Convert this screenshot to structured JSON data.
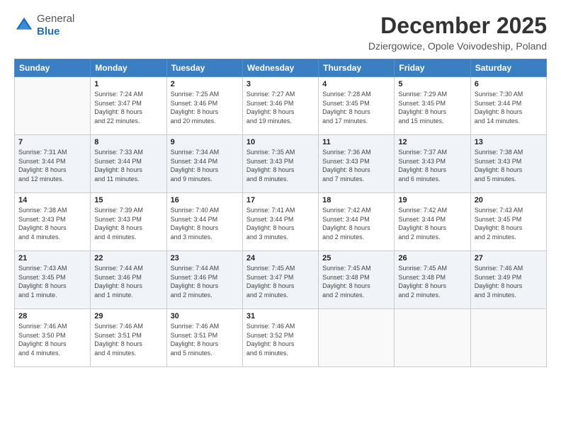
{
  "logo": {
    "general": "General",
    "blue": "Blue"
  },
  "header": {
    "month": "December 2025",
    "location": "Dziergowice, Opole Voivodeship, Poland"
  },
  "weekdays": [
    "Sunday",
    "Monday",
    "Tuesday",
    "Wednesday",
    "Thursday",
    "Friday",
    "Saturday"
  ],
  "weeks": [
    [
      {
        "day": "",
        "info": ""
      },
      {
        "day": "1",
        "info": "Sunrise: 7:24 AM\nSunset: 3:47 PM\nDaylight: 8 hours\nand 22 minutes."
      },
      {
        "day": "2",
        "info": "Sunrise: 7:25 AM\nSunset: 3:46 PM\nDaylight: 8 hours\nand 20 minutes."
      },
      {
        "day": "3",
        "info": "Sunrise: 7:27 AM\nSunset: 3:46 PM\nDaylight: 8 hours\nand 19 minutes."
      },
      {
        "day": "4",
        "info": "Sunrise: 7:28 AM\nSunset: 3:45 PM\nDaylight: 8 hours\nand 17 minutes."
      },
      {
        "day": "5",
        "info": "Sunrise: 7:29 AM\nSunset: 3:45 PM\nDaylight: 8 hours\nand 15 minutes."
      },
      {
        "day": "6",
        "info": "Sunrise: 7:30 AM\nSunset: 3:44 PM\nDaylight: 8 hours\nand 14 minutes."
      }
    ],
    [
      {
        "day": "7",
        "info": "Sunrise: 7:31 AM\nSunset: 3:44 PM\nDaylight: 8 hours\nand 12 minutes."
      },
      {
        "day": "8",
        "info": "Sunrise: 7:33 AM\nSunset: 3:44 PM\nDaylight: 8 hours\nand 11 minutes."
      },
      {
        "day": "9",
        "info": "Sunrise: 7:34 AM\nSunset: 3:44 PM\nDaylight: 8 hours\nand 9 minutes."
      },
      {
        "day": "10",
        "info": "Sunrise: 7:35 AM\nSunset: 3:43 PM\nDaylight: 8 hours\nand 8 minutes."
      },
      {
        "day": "11",
        "info": "Sunrise: 7:36 AM\nSunset: 3:43 PM\nDaylight: 8 hours\nand 7 minutes."
      },
      {
        "day": "12",
        "info": "Sunrise: 7:37 AM\nSunset: 3:43 PM\nDaylight: 8 hours\nand 6 minutes."
      },
      {
        "day": "13",
        "info": "Sunrise: 7:38 AM\nSunset: 3:43 PM\nDaylight: 8 hours\nand 5 minutes."
      }
    ],
    [
      {
        "day": "14",
        "info": "Sunrise: 7:38 AM\nSunset: 3:43 PM\nDaylight: 8 hours\nand 4 minutes."
      },
      {
        "day": "15",
        "info": "Sunrise: 7:39 AM\nSunset: 3:43 PM\nDaylight: 8 hours\nand 4 minutes."
      },
      {
        "day": "16",
        "info": "Sunrise: 7:40 AM\nSunset: 3:44 PM\nDaylight: 8 hours\nand 3 minutes."
      },
      {
        "day": "17",
        "info": "Sunrise: 7:41 AM\nSunset: 3:44 PM\nDaylight: 8 hours\nand 3 minutes."
      },
      {
        "day": "18",
        "info": "Sunrise: 7:42 AM\nSunset: 3:44 PM\nDaylight: 8 hours\nand 2 minutes."
      },
      {
        "day": "19",
        "info": "Sunrise: 7:42 AM\nSunset: 3:44 PM\nDaylight: 8 hours\nand 2 minutes."
      },
      {
        "day": "20",
        "info": "Sunrise: 7:43 AM\nSunset: 3:45 PM\nDaylight: 8 hours\nand 2 minutes."
      }
    ],
    [
      {
        "day": "21",
        "info": "Sunrise: 7:43 AM\nSunset: 3:45 PM\nDaylight: 8 hours\nand 1 minute."
      },
      {
        "day": "22",
        "info": "Sunrise: 7:44 AM\nSunset: 3:46 PM\nDaylight: 8 hours\nand 1 minute."
      },
      {
        "day": "23",
        "info": "Sunrise: 7:44 AM\nSunset: 3:46 PM\nDaylight: 8 hours\nand 2 minutes."
      },
      {
        "day": "24",
        "info": "Sunrise: 7:45 AM\nSunset: 3:47 PM\nDaylight: 8 hours\nand 2 minutes."
      },
      {
        "day": "25",
        "info": "Sunrise: 7:45 AM\nSunset: 3:48 PM\nDaylight: 8 hours\nand 2 minutes."
      },
      {
        "day": "26",
        "info": "Sunrise: 7:45 AM\nSunset: 3:48 PM\nDaylight: 8 hours\nand 2 minutes."
      },
      {
        "day": "27",
        "info": "Sunrise: 7:46 AM\nSunset: 3:49 PM\nDaylight: 8 hours\nand 3 minutes."
      }
    ],
    [
      {
        "day": "28",
        "info": "Sunrise: 7:46 AM\nSunset: 3:50 PM\nDaylight: 8 hours\nand 4 minutes."
      },
      {
        "day": "29",
        "info": "Sunrise: 7:46 AM\nSunset: 3:51 PM\nDaylight: 8 hours\nand 4 minutes."
      },
      {
        "day": "30",
        "info": "Sunrise: 7:46 AM\nSunset: 3:51 PM\nDaylight: 8 hours\nand 5 minutes."
      },
      {
        "day": "31",
        "info": "Sunrise: 7:46 AM\nSunset: 3:52 PM\nDaylight: 8 hours\nand 6 minutes."
      },
      {
        "day": "",
        "info": ""
      },
      {
        "day": "",
        "info": ""
      },
      {
        "day": "",
        "info": ""
      }
    ]
  ]
}
